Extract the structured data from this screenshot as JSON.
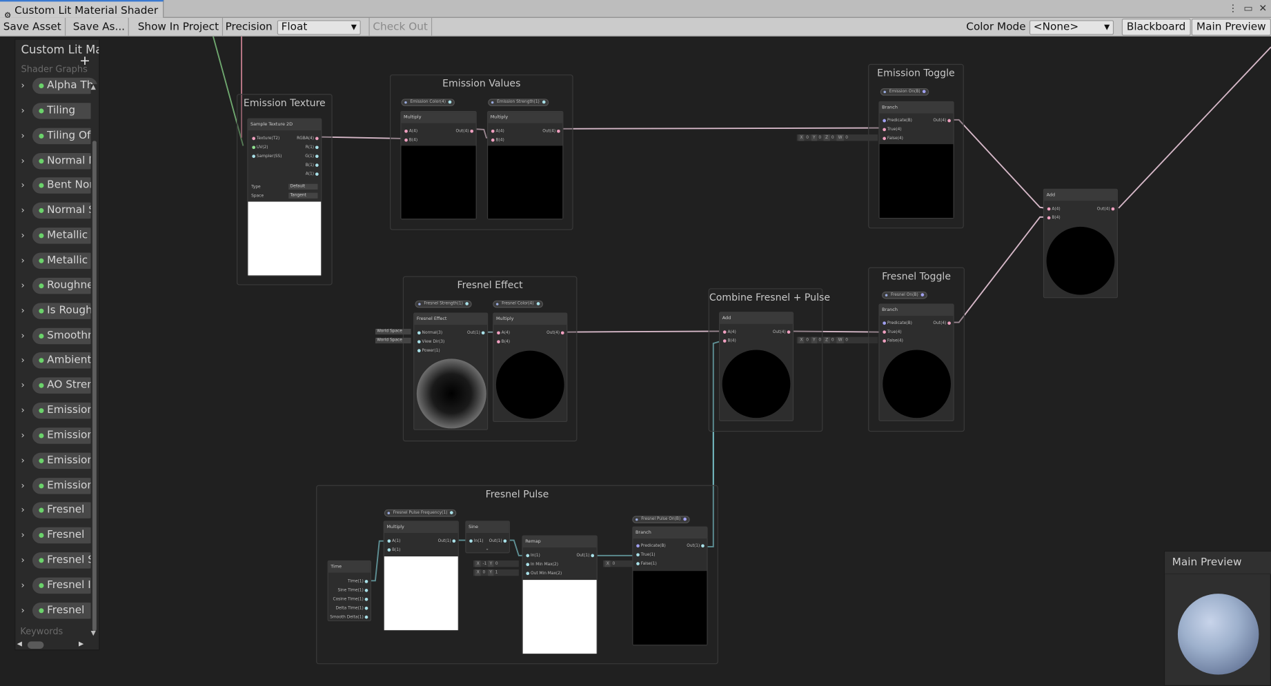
{
  "window": {
    "title": "Custom Lit Material Shader"
  },
  "toolbar": {
    "save_asset": "Save Asset",
    "save_as": "Save As...",
    "show_in_project": "Show In Project",
    "precision_label": "Precision",
    "precision_value": "Float",
    "check_out": "Check Out",
    "color_mode_label": "Color Mode",
    "color_mode_value": "<None>",
    "blackboard": "Blackboard",
    "main_preview": "Main Preview"
  },
  "blackboard": {
    "title": "Custom Lit Ma",
    "subtitle": "Shader Graphs",
    "keywords": "Keywords",
    "items": [
      "Alpha Th",
      "Tiling",
      "Tiling Of",
      "Normal M",
      "Bent Nor",
      "Normal S",
      "Metallic",
      "Metallic",
      "Roughne",
      "Is Rough",
      "Smoothn",
      "Ambient",
      "AO Stren",
      "Emission",
      "Emission",
      "Emission",
      "Emission",
      "Fresnel",
      "Fresnel",
      "Fresnel S",
      "Fresnel I",
      "Fresnel"
    ]
  },
  "groups": {
    "emission_texture": "Emission Texture",
    "emission_values": "Emission Values",
    "emission_toggle": "Emission Toggle",
    "fresnel_effect": "Fresnel Effect",
    "combine": "Combine Fresnel + Pulse",
    "fresnel_toggle": "Fresnel Toggle",
    "fresnel_pulse": "Fresnel Pulse"
  },
  "nodes": {
    "sample_tex": "Sample Texture 2D",
    "multiply": "Multiply",
    "branch": "Branch",
    "add": "Add",
    "fresnel": "Fresnel Effect",
    "sine": "Sine",
    "remap": "Remap",
    "time": "Time",
    "emission_color": "Emission Color(4)",
    "emission_strength": "Emission Strength(1)",
    "emission_on": "Emission On(B)",
    "fresnel_strength": "Fresnel Strength(1)",
    "fresnel_color": "Fresnel Color(4)",
    "fresnel_on": "Fresnel On(B)",
    "pulse_freq": "Fresnel Pulse Frequency(1)",
    "pulse_on": "Fresnel Pulse On(B)",
    "texture_port": "Texture(T2)",
    "uv_port": "UV(2)",
    "sampler_port": "Sampler(SS)",
    "rgba": "RGBA(4)",
    "r": "R(1)",
    "g": "G(1)",
    "b": "B(1)",
    "a": "A(1)",
    "type": "Type",
    "type_val": "Default",
    "space": "Space",
    "space_val": "Tangent",
    "a4": "A(4)",
    "b4": "B(4)",
    "out4": "Out(4)",
    "a1": "A(1)",
    "b1": "B(1)",
    "out1": "Out(1)",
    "predicate": "Predicate(B)",
    "true4": "True(4)",
    "false4": "False(4)",
    "true1": "True(1)",
    "false1": "False(1)",
    "normal3": "Normal(3)",
    "viewdir": "View Dir(3)",
    "power1": "Power(1)",
    "in1": "In(1)",
    "inminmax": "In Min Max(2)",
    "outminmax": "Out Min Max(2)",
    "time1": "Time(1)",
    "sine_time": "Sine Time(1)",
    "cos_time": "Cosine Time(1)",
    "delta_time": "Delta Time(1)",
    "smooth_delta": "Smooth Delta(1)",
    "world_space": "World Space",
    "x": "X",
    "y": "Y",
    "z": "Z",
    "w": "W",
    "zero": "0",
    "one": "1"
  },
  "main_preview": {
    "title": "Main Preview"
  }
}
